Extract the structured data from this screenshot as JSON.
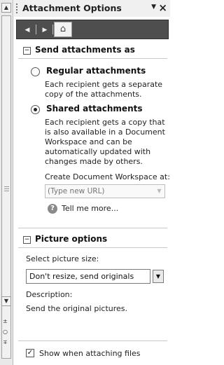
{
  "pane": {
    "title": "Attachment Options",
    "menu_glyph": "▼",
    "close_glyph": "×"
  },
  "nav": {
    "back_glyph": "◀",
    "forward_glyph": "▶",
    "home_glyph": "⌂"
  },
  "send_section": {
    "collapse_glyph": "−",
    "title": "Send attachments as",
    "regular": {
      "label": "Regular attachments",
      "selected": false,
      "description": "Each recipient gets a separate copy of the attachments."
    },
    "shared": {
      "label": "Shared attachments",
      "selected": true,
      "description": "Each recipient gets a copy that is also available in a Document Workspace and can be automatically updated with changes made by others."
    },
    "workspace_label": "Create Document Workspace at:",
    "workspace_placeholder": "(Type new URL)",
    "help_glyph": "?",
    "help_link": "Tell me more..."
  },
  "picture_section": {
    "collapse_glyph": "−",
    "title": "Picture options",
    "select_label": "Select picture size:",
    "selected_size": "Don't resize, send originals",
    "description_label": "Description:",
    "description": "Send the original pictures."
  },
  "footer": {
    "show_when_attaching_label": "Show when attaching files",
    "show_when_attaching_checked": true,
    "check_glyph": "✓"
  },
  "scrollbar": {
    "up_glyph": "▲",
    "down_glyph": "▼",
    "prev_glyph": "±",
    "select_glyph": "○",
    "next_glyph": "∓"
  }
}
